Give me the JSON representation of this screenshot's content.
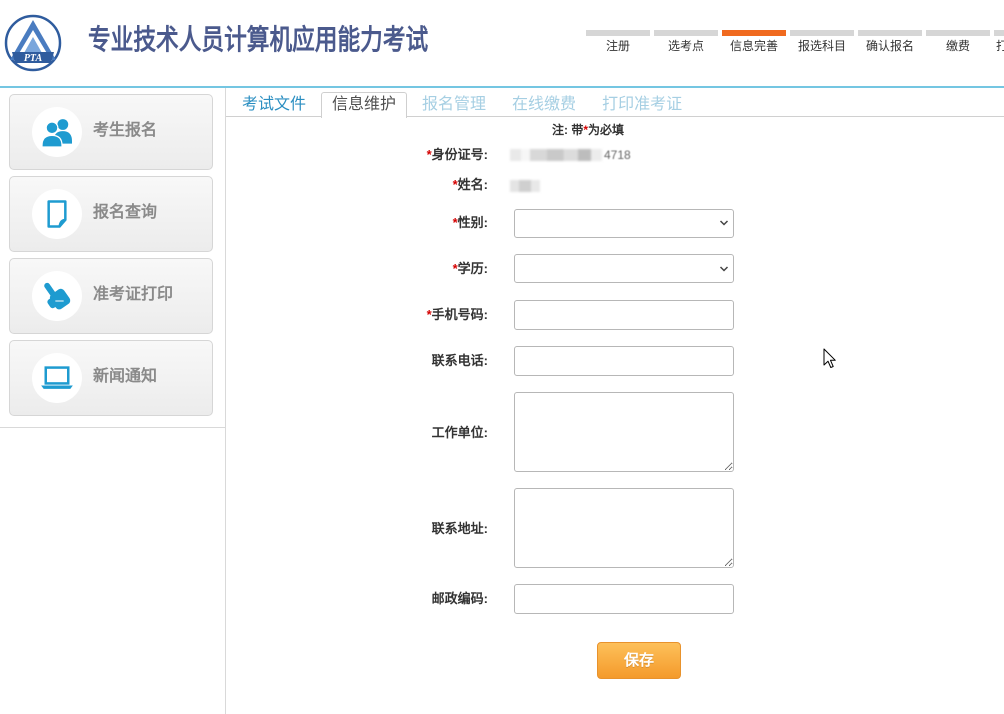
{
  "header": {
    "logo_text": "PTA",
    "title": "专业技术人员计算机应用能力考试"
  },
  "steps": [
    {
      "label": "注册",
      "active": false
    },
    {
      "label": "选考点",
      "active": false
    },
    {
      "label": "信息完善",
      "active": true
    },
    {
      "label": "报选科目",
      "active": false
    },
    {
      "label": "确认报名",
      "active": false
    },
    {
      "label": "缴费",
      "active": false
    },
    {
      "label": "打",
      "active": false
    }
  ],
  "sidebar": {
    "items": [
      {
        "label": "考生报名",
        "icon": "users-icon"
      },
      {
        "label": "报名查询",
        "icon": "document-icon"
      },
      {
        "label": "准考证打印",
        "icon": "pointing-hand-icon"
      },
      {
        "label": "新闻通知",
        "icon": "laptop-icon"
      }
    ]
  },
  "tabs": [
    {
      "label": "考试文件",
      "active": false,
      "disabled": false
    },
    {
      "label": "信息维护",
      "active": true,
      "disabled": false
    },
    {
      "label": "报名管理",
      "active": false,
      "disabled": true
    },
    {
      "label": "在线缴费",
      "active": false,
      "disabled": true
    },
    {
      "label": "打印准考证",
      "active": false,
      "disabled": true
    }
  ],
  "form": {
    "note": {
      "prefix": "注: 带",
      "mark": "*",
      "suffix": "为必填"
    },
    "required_mark": "*",
    "fields": [
      {
        "label": "身份证号:",
        "required": true,
        "value": "4718"
      },
      {
        "label": "姓名:",
        "required": true,
        "value": ""
      },
      {
        "label": "性别:",
        "required": true,
        "value": ""
      },
      {
        "label": "学历:",
        "required": true,
        "value": ""
      },
      {
        "label": "手机号码:",
        "required": true,
        "value": ""
      },
      {
        "label": "联系电话:",
        "required": false,
        "value": ""
      },
      {
        "label": "工作单位:",
        "required": false,
        "value": ""
      },
      {
        "label": "联系地址:",
        "required": false,
        "value": ""
      },
      {
        "label": "邮政编码:",
        "required": false,
        "value": ""
      }
    ]
  },
  "actions": {
    "save_label": "保存"
  },
  "colors": {
    "title": "#4b5a8d",
    "step_active": "#f06a1f",
    "step_inactive": "#d6d6d6",
    "header_line": "#74c6e2",
    "icon_blue": "#1e9bd0",
    "tab_link": "#2a8ec1",
    "tab_disabled": "#a6cfe3",
    "required": "#d40000",
    "save_button": "#f7a63a"
  }
}
